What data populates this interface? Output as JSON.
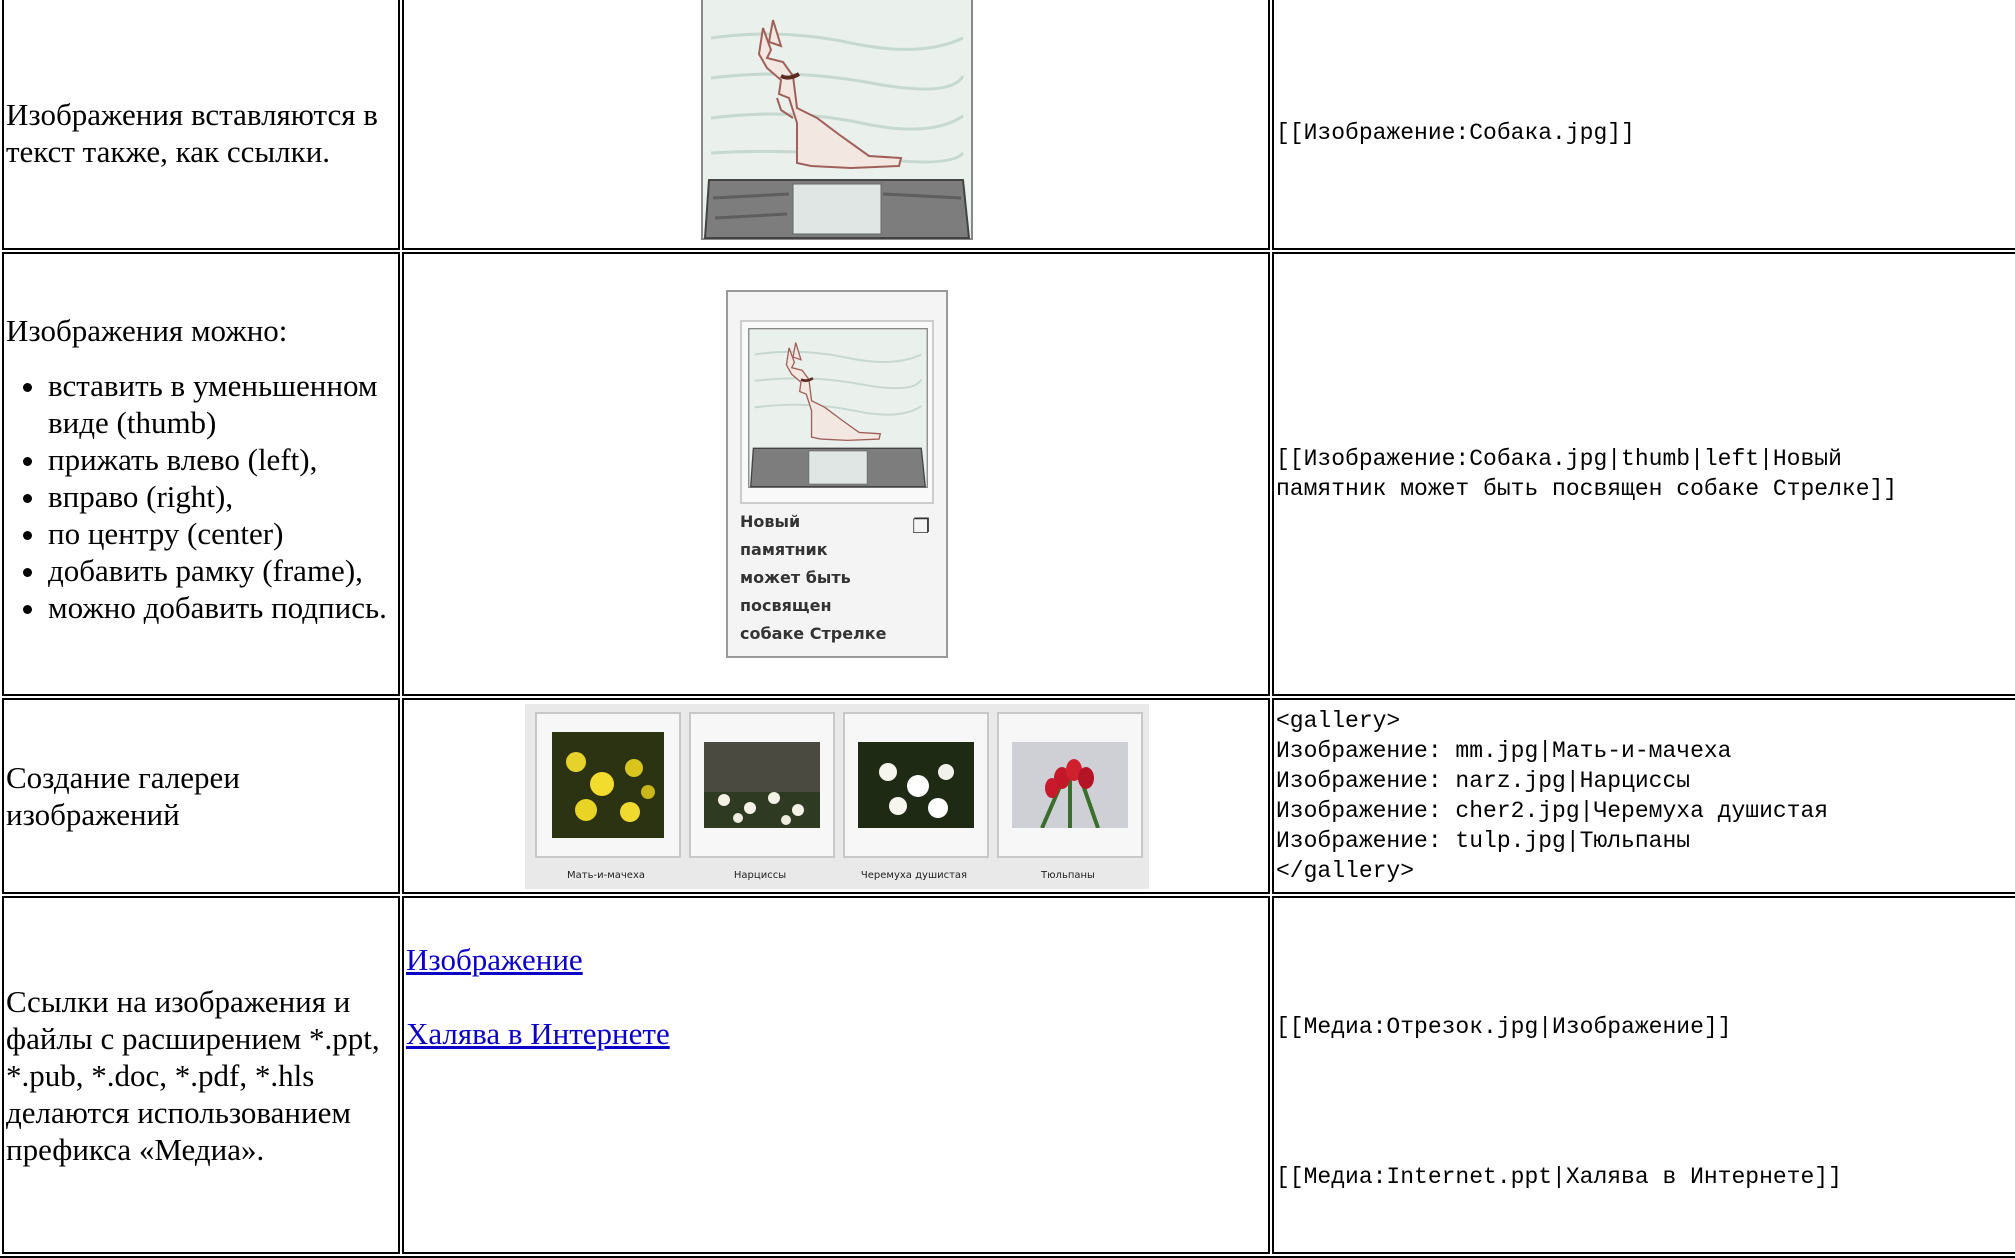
{
  "rows": [
    {
      "description": "Изображения вставляются в текст также,  как ссылки.",
      "code": "[[Изображение:Собака.jpg]]"
    },
    {
      "intro": "Изображения можно:",
      "items": [
        "вставить в уменьшенном виде (thumb)",
        "прижать влево (left),",
        "вправо (right),",
        "по центру (center)",
        "добавить рамку (frame),",
        "можно добавить подпись."
      ],
      "thumb_caption": "Новый памятник может быть посвящен собаке Стрелке",
      "code": "[[Изображение:Собака.jpg|thumb|left|Новый\nпамятник может быть посвящен собаке Стрелке]]"
    },
    {
      "description": "Создание галереи изображений",
      "gallery": [
        {
          "caption": "Мать-и-мачеха"
        },
        {
          "caption": "Нарциссы"
        },
        {
          "caption": "Черемуха душистая"
        },
        {
          "caption": "Тюльпаны"
        }
      ],
      "code": "<gallery>\nИзображение: mm.jpg|Мать-и-мачеха\nИзображение: narz.jpg|Нарциссы\nИзображение: cher2.jpg|Черемуха душистая\nИзображение: tulp.jpg|Тюльпаны\n</gallery>"
    },
    {
      "description": "Ссылки на изображения и файлы с расширением *.ppt, *.pub, *.doc, *.pdf, *.hls делаются использованием префикса «Медиа».",
      "links": [
        "Изображение",
        "Халява в Интернете"
      ],
      "code1": "[[Медиа:Отрезок.jpg|Изображение]]",
      "code2": "[[Медиа:Internet.ppt|Халява в Интернете]]"
    }
  ]
}
